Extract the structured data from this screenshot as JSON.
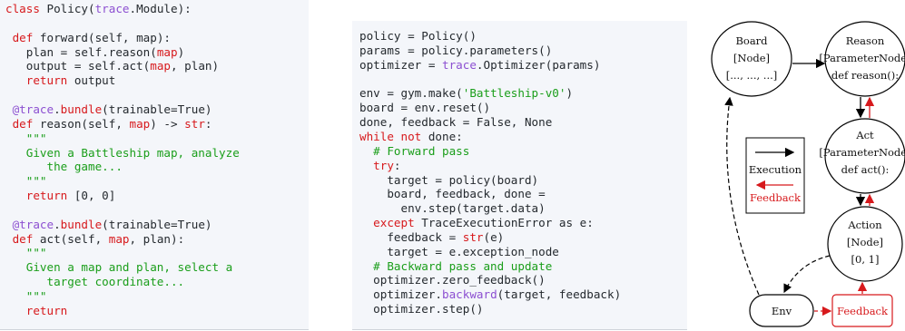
{
  "left_code": {
    "lines": [
      [
        {
          "t": "class ",
          "c": "kw"
        },
        {
          "t": "Policy(trace.Module):",
          "c": "mix1"
        }
      ],
      [],
      [
        {
          "t": " def ",
          "c": "kw"
        },
        {
          "t": "forward(self, map):",
          "c": ""
        }
      ],
      [
        {
          "t": "   plan = self.reason(",
          "c": ""
        },
        {
          "t": "map",
          "c": "rd"
        },
        {
          "t": ")",
          "c": ""
        }
      ],
      [
        {
          "t": "   output = self.act(",
          "c": ""
        },
        {
          "t": "map",
          "c": "rd"
        },
        {
          "t": ", plan)",
          "c": ""
        }
      ],
      [
        {
          "t": "   ",
          "c": ""
        },
        {
          "t": "return",
          "c": "kw"
        },
        {
          "t": " output",
          "c": ""
        }
      ],
      [],
      [
        {
          "t": " @trace",
          "c": "dc"
        },
        {
          "t": ".",
          "c": ""
        },
        {
          "t": "bundle",
          "c": "rd"
        },
        {
          "t": "(trainable=True)",
          "c": ""
        }
      ],
      [
        {
          "t": " def ",
          "c": "kw"
        },
        {
          "t": "reason(self, ",
          "c": ""
        },
        {
          "t": "map",
          "c": "rd"
        },
        {
          "t": ") -> ",
          "c": ""
        },
        {
          "t": "str",
          "c": "rd"
        },
        {
          "t": ":",
          "c": ""
        }
      ],
      [
        {
          "t": "   \"\"\"",
          "c": "st"
        }
      ],
      [
        {
          "t": "   Given a Battleship map, analyze",
          "c": "st"
        }
      ],
      [
        {
          "t": "      the game...",
          "c": "st"
        }
      ],
      [
        {
          "t": "   \"\"\"",
          "c": "st"
        }
      ],
      [
        {
          "t": "   ",
          "c": ""
        },
        {
          "t": "return",
          "c": "kw"
        },
        {
          "t": " [0, 0]",
          "c": ""
        }
      ],
      [],
      [
        {
          "t": " @trace",
          "c": "dc"
        },
        {
          "t": ".",
          "c": ""
        },
        {
          "t": "bundle",
          "c": "rd"
        },
        {
          "t": "(trainable=True)",
          "c": ""
        }
      ],
      [
        {
          "t": " def ",
          "c": "kw"
        },
        {
          "t": "act(self, ",
          "c": ""
        },
        {
          "t": "map",
          "c": "rd"
        },
        {
          "t": ", plan):",
          "c": ""
        }
      ],
      [
        {
          "t": "   \"\"\"",
          "c": "st"
        }
      ],
      [
        {
          "t": "   Given a map and plan, select a",
          "c": "st"
        }
      ],
      [
        {
          "t": "      target coordinate...",
          "c": "st"
        }
      ],
      [
        {
          "t": "   \"\"\"",
          "c": "st"
        }
      ],
      [
        {
          "t": "   ",
          "c": ""
        },
        {
          "t": "return",
          "c": "kw"
        }
      ]
    ]
  },
  "mid_code": {
    "lines": [
      [
        {
          "t": "policy = Policy()",
          "c": ""
        }
      ],
      [
        {
          "t": "params = policy.parameters()",
          "c": ""
        }
      ],
      [
        {
          "t": "optimizer = ",
          "c": ""
        },
        {
          "t": "trace",
          "c": "dc"
        },
        {
          "t": ".Optimizer(params)",
          "c": ""
        }
      ],
      [],
      [
        {
          "t": "env = gym.make(",
          "c": ""
        },
        {
          "t": "'Battleship-v0'",
          "c": "st"
        },
        {
          "t": ")",
          "c": ""
        }
      ],
      [
        {
          "t": "board = env.reset()",
          "c": ""
        }
      ],
      [
        {
          "t": "done, feedback = False, None",
          "c": ""
        }
      ],
      [
        {
          "t": "while not ",
          "c": "kw"
        },
        {
          "t": "done:",
          "c": ""
        }
      ],
      [
        {
          "t": "  # Forward pass",
          "c": "cm"
        }
      ],
      [
        {
          "t": "  try",
          "c": "kw"
        },
        {
          "t": ":",
          "c": ""
        }
      ],
      [
        {
          "t": "    target = policy(board)",
          "c": ""
        }
      ],
      [
        {
          "t": "    board, feedback, done =",
          "c": ""
        }
      ],
      [
        {
          "t": "      env.step(target.data)",
          "c": ""
        }
      ],
      [
        {
          "t": "  except ",
          "c": "kw"
        },
        {
          "t": "TraceExecutionError as e:",
          "c": ""
        }
      ],
      [
        {
          "t": "    feedback = ",
          "c": ""
        },
        {
          "t": "str",
          "c": "rd"
        },
        {
          "t": "(e)",
          "c": ""
        }
      ],
      [
        {
          "t": "    target = e.exception_node",
          "c": ""
        }
      ],
      [
        {
          "t": "  # Backward pass and update",
          "c": "cm"
        }
      ],
      [
        {
          "t": "  optimizer.zero_feedback()",
          "c": ""
        }
      ],
      [
        {
          "t": "  optimizer.",
          "c": ""
        },
        {
          "t": "backward",
          "c": "dc"
        },
        {
          "t": "(target, feedback)",
          "c": ""
        }
      ],
      [
        {
          "t": "  optimizer.step()",
          "c": ""
        }
      ]
    ]
  },
  "diagram": {
    "board": [
      "Board",
      "[Node]",
      "[..., ..., ...]"
    ],
    "reason": [
      "Reason",
      "[ParameterNode]",
      "def reason():"
    ],
    "act": [
      "Act",
      "[ParameterNode]",
      "def act():"
    ],
    "action": [
      "Action",
      "[Node]",
      "[0, 1]"
    ],
    "env": "Env",
    "feedback": "Feedback",
    "legend": {
      "execution": "Execution",
      "feedback": "Feedback"
    },
    "colors": {
      "execution": "#000000",
      "feedback": "#d7191c"
    }
  }
}
